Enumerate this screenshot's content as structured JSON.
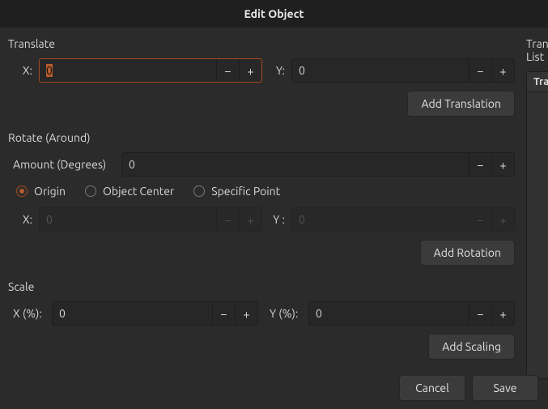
{
  "title": "Edit Object",
  "translate": {
    "label": "Translate",
    "x_label": "X:",
    "y_label": "Y:",
    "x_value": "0",
    "y_value": "0",
    "add_label": "Add Translation"
  },
  "rotate": {
    "label": "Rotate (Around)",
    "amount_label": "Amount (Degrees)",
    "amount_value": "0",
    "radio_origin": "Origin",
    "radio_center": "Object Center",
    "radio_point": "Specific Point",
    "x_label": "X:",
    "y_label": "Y :",
    "x_value": "0",
    "y_value": "0",
    "add_label": "Add Rotation"
  },
  "scale": {
    "label": "Scale",
    "x_label": "X (%):",
    "y_label": "Y (%):",
    "x_value": "0",
    "y_value": "0",
    "add_label": "Add Scaling"
  },
  "list": {
    "label": "Transformations List",
    "column": "Transformation"
  },
  "footer": {
    "cancel": "Cancel",
    "save": "Save"
  },
  "icons": {
    "minus": "−",
    "plus": "+"
  }
}
